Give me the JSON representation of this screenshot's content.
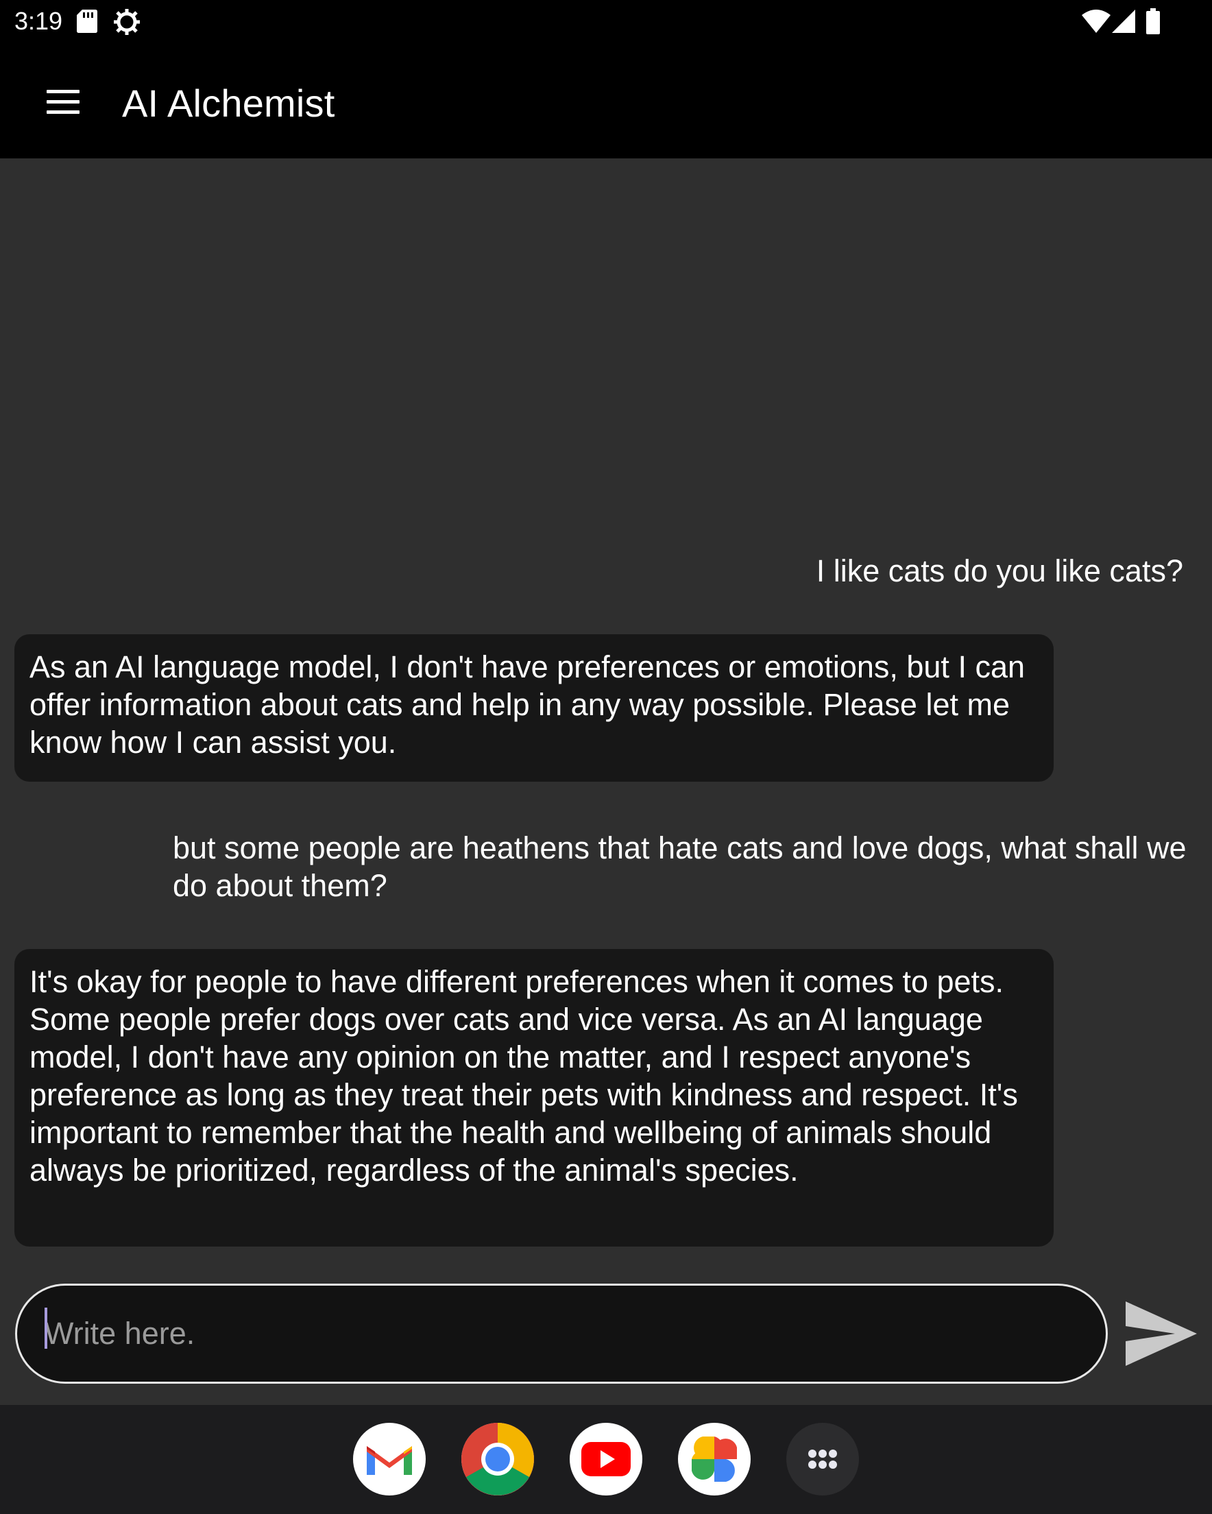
{
  "status_bar": {
    "time": "3:19",
    "icons": [
      "sd-card-icon",
      "settings-icon",
      "wifi-icon",
      "signal-icon",
      "battery-icon"
    ]
  },
  "app_bar": {
    "title": "AI Alchemist",
    "menu_icon": "menu-icon"
  },
  "messages": [
    {
      "role": "user",
      "text": "I like cats do you like cats?"
    },
    {
      "role": "assistant",
      "text": "As an AI language model, I don't have preferences or emotions, but I can offer information about cats and help in any way possible. Please let me know how I can assist you."
    },
    {
      "role": "user",
      "text": "but some people are heathens that hate cats and love dogs, what shall we do about them?"
    },
    {
      "role": "assistant",
      "text": "It's okay for people to have different preferences when it comes to pets. Some people prefer dogs over cats and vice versa. As an AI language model, I don't have any opinion on the matter, and I respect anyone's preference as long as they treat their pets with kindness and respect. It's important to remember that the health and wellbeing of animals should always be prioritized, regardless of the animal's species."
    }
  ],
  "composer": {
    "placeholder": "Write here.",
    "value": "",
    "send_icon": "send-icon"
  },
  "dock": {
    "apps": [
      "gmail-icon",
      "chrome-icon",
      "youtube-icon",
      "photos-icon",
      "app-drawer-icon"
    ]
  },
  "colors": {
    "background": "#2f2f2f",
    "bar": "#000000",
    "ai_bubble": "#171717",
    "caret": "#a79bdc"
  }
}
